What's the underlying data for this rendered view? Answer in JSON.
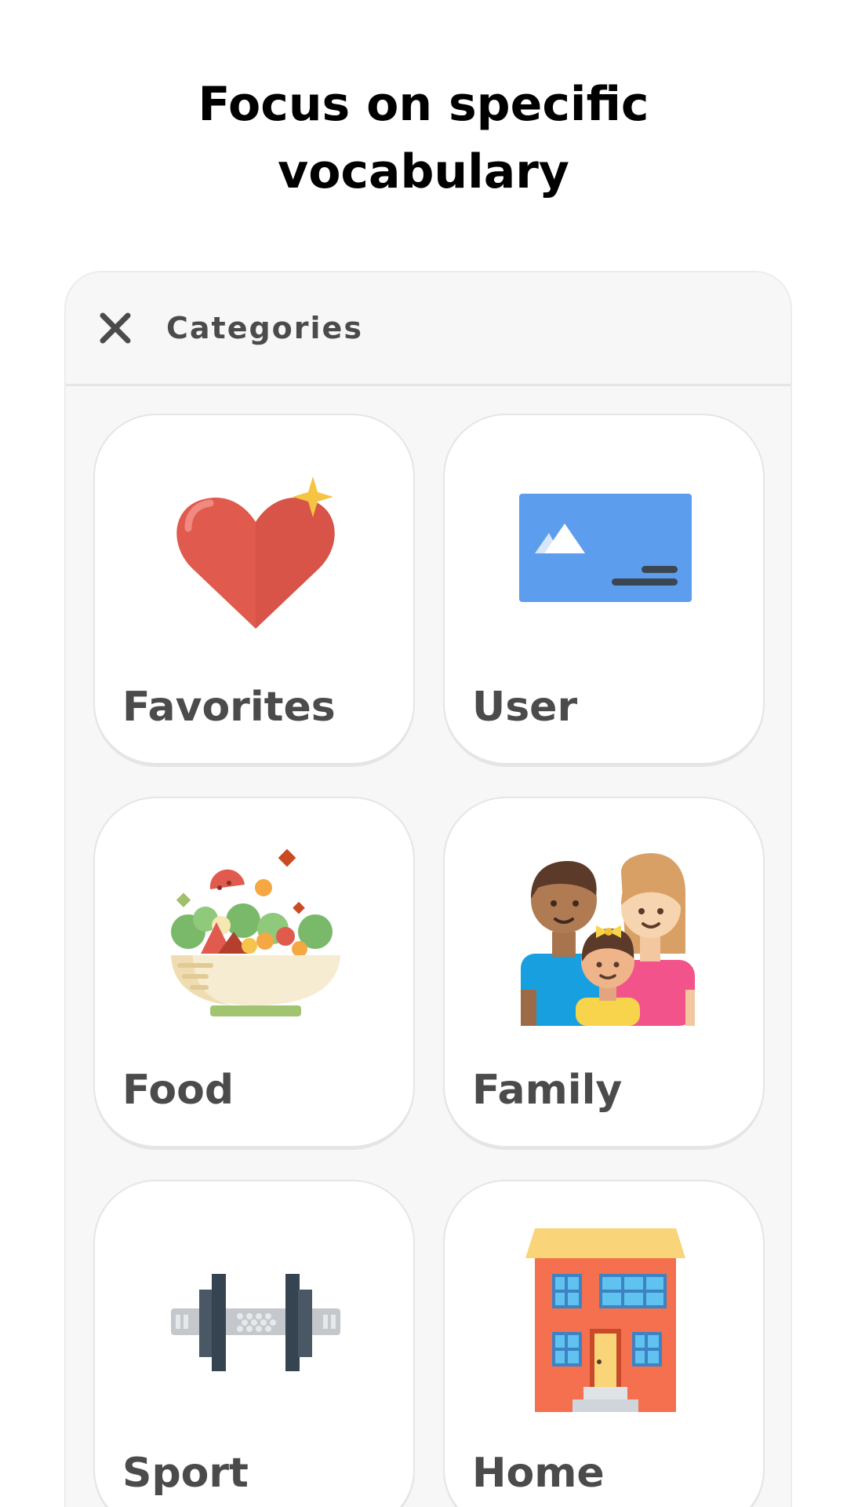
{
  "headline": {
    "line1": "Focus on specific",
    "line2": "vocabulary"
  },
  "panel": {
    "title": "Categories",
    "close_icon": "close-icon"
  },
  "categories": [
    {
      "label": "Favorites",
      "icon": "heart-icon"
    },
    {
      "label": "User",
      "icon": "id-card-icon"
    },
    {
      "label": "Food",
      "icon": "salad-bowl-icon"
    },
    {
      "label": "Family",
      "icon": "family-icon"
    },
    {
      "label": "Sport",
      "icon": "dumbbell-icon"
    },
    {
      "label": "Home",
      "icon": "house-icon"
    }
  ],
  "colors": {
    "text_dark": "#4b4b4b",
    "panel_bg": "#f7f7f7",
    "card_border": "#e5e5e5"
  }
}
